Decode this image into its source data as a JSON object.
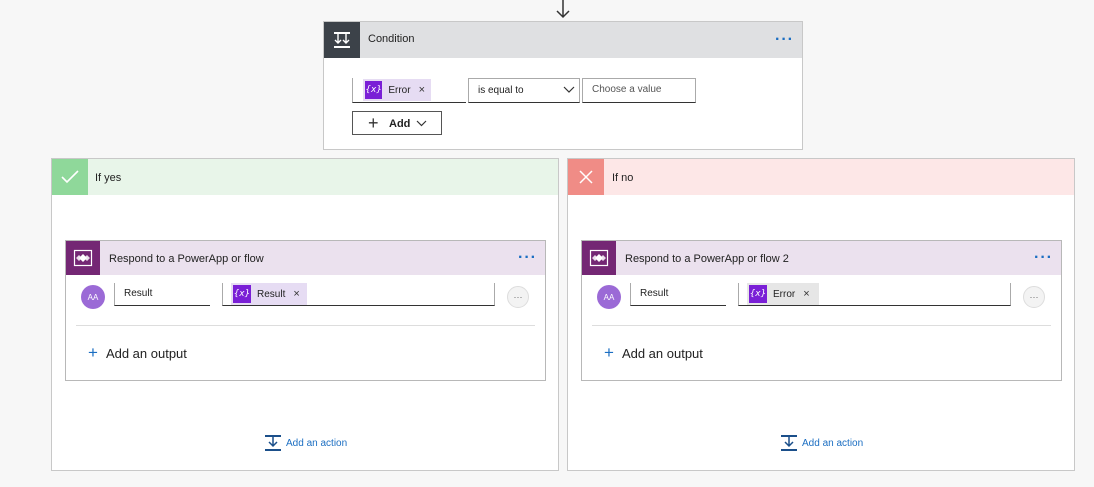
{
  "condition": {
    "title": "Condition",
    "token_label": "Error",
    "operator": "is equal to",
    "value_placeholder": "Choose a value",
    "add_label": "Add"
  },
  "branches": {
    "yes": {
      "header": "If yes",
      "action_title": "Respond to a PowerApp or flow",
      "output_name": "Result",
      "output_token": "Result",
      "add_output": "Add an output",
      "add_action": "Add an action"
    },
    "no": {
      "header": "If no",
      "action_title": "Respond to a PowerApp or flow 2",
      "output_name": "Result",
      "output_token": "Error",
      "add_output": "Add an output",
      "add_action": "Add an action"
    }
  },
  "icons": {
    "token": "{x}",
    "avatar": "AA",
    "add": "+",
    "remove": "×",
    "more": "···"
  },
  "colors": {
    "condition_header": "#dfe0e2",
    "condition_icon_bg": "#3c4249",
    "yes_header": "#e8f5e9",
    "yes_icon_bg": "#8fd89a",
    "no_header": "#fde7e7",
    "no_icon_bg": "#f08c86",
    "action_header": "#ebe1ee",
    "action_icon_bg": "#742774",
    "token_bg": "#e6dcf3",
    "accent": "#1b6ec2"
  }
}
